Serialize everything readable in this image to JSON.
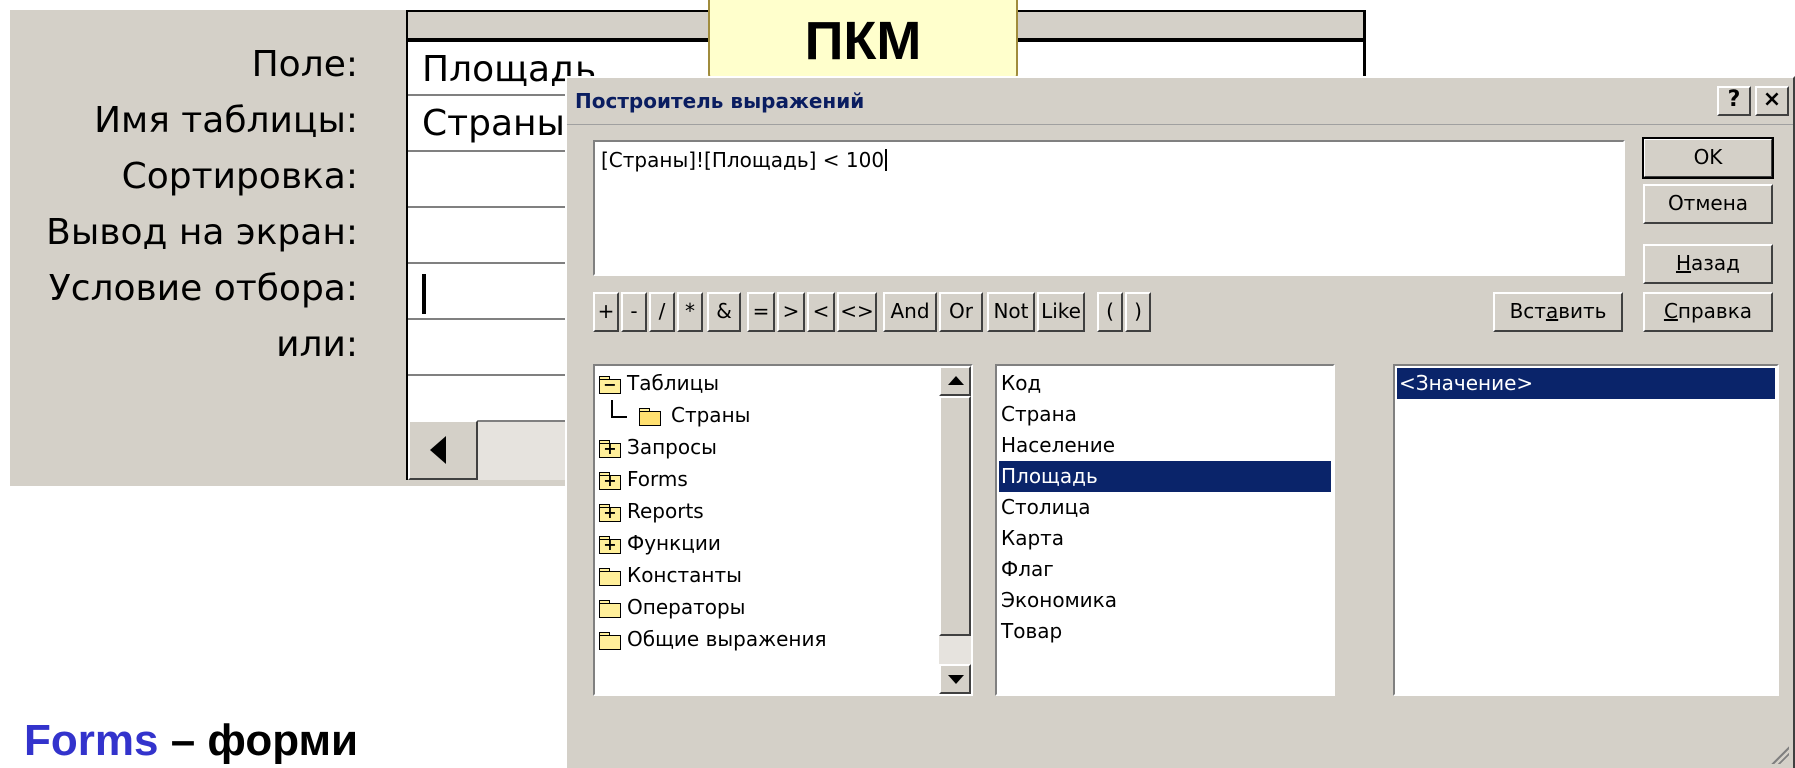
{
  "grid": {
    "labels": {
      "field": "Поле:",
      "table": "Имя таблицы:",
      "sort": "Сортировка:",
      "show": "Вывод на экран:",
      "criteria": "Условие отбора:",
      "or": "или:"
    },
    "cells": {
      "field": "Площадь",
      "table": "Страны"
    }
  },
  "callout": {
    "text": "ПКМ"
  },
  "caption": {
    "accent": "Forms",
    "rest": " – форми"
  },
  "dialog": {
    "title": "Построитель выражений",
    "help_button": "?",
    "close_button": "×",
    "expression": "[Страны]![Площадь] < 100",
    "buttons": {
      "ok": "OK",
      "cancel": "Отмена",
      "back_pre": "",
      "back_u": "Н",
      "back_post": "азад",
      "help_pre": "",
      "help_u": "С",
      "help_post": "правка",
      "insert_pre": "Вст",
      "insert_u": "а",
      "insert_post": "вить"
    },
    "operators": [
      "+",
      "-",
      "/",
      "*",
      "&",
      "=",
      ">",
      "<",
      "<>",
      "And",
      "Or",
      "Not",
      "Like",
      "(",
      ")"
    ],
    "tree": {
      "tables": "Таблицы",
      "countries": "Страны",
      "queries": "Запросы",
      "forms": "Forms",
      "reports": "Reports",
      "functions": "Функции",
      "constants": "Константы",
      "operators": "Операторы",
      "common": "Общие выражения"
    },
    "fields": [
      "Код",
      "Страна",
      "Население",
      "Площадь",
      "Столица",
      "Карта",
      "Флаг",
      "Экономика",
      "Товар"
    ],
    "selected_field_index": 3,
    "values": [
      "<Значение>"
    ]
  }
}
